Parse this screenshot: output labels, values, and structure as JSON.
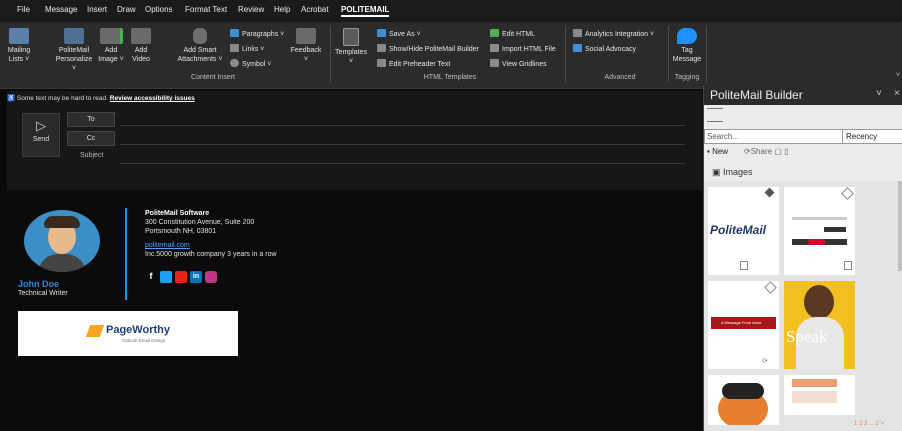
{
  "menu": [
    "File",
    "Message",
    "Insert",
    "Draw",
    "Options",
    "Format Text",
    "Review",
    "Help",
    "Acrobat",
    "POLITEMAIL"
  ],
  "ribbon": {
    "mailing_lists": "Mailing\nLists ˅",
    "politemail_personalize": "PoliteMail\nPersonalize ˅",
    "add_image": "Add\nImage ˅",
    "add_video": "Add\nVideo",
    "add_smart_attachments": "Add Smart\nAttachments ˅",
    "paragraphs": "Paragraphs ˅",
    "links": "Links ˅",
    "symbol": "Symbol ˅",
    "feedback": "Feedback\n˅",
    "templates": "Templates\n˅",
    "save_as": "Save As ˅",
    "show_hide_builder": "Show/Hide PoliteMail Builder",
    "edit_preheader": "Edit Preheader Text",
    "edit_html": "Edit HTML",
    "import_html": "Import HTML File",
    "view_gridlines": "View Gridlines",
    "analytics_integration": "Analytics Integration ˅",
    "social_advocacy": "Social Advocacy",
    "tag_message": "Tag\nMessage",
    "groups": {
      "content_insert": "Content Insert",
      "html_templates": "HTML Templates",
      "advanced": "Advanced",
      "tagging": "Tagging"
    }
  },
  "compose": {
    "accessibility_text": "Some text may be hard to read.",
    "accessibility_link": "Review accessibility issues",
    "send": "Send",
    "to": "To",
    "cc": "Cc",
    "subject": "Subject"
  },
  "signature": {
    "name": "John Doe",
    "title": "Technical Writer",
    "company": "PoliteMail Software",
    "address1": "300 Constitution Avenue, Suite 200",
    "address2": "Portsmouth NH, 03801",
    "website": "politemail.com",
    "tagline": "Inc.5000 growth company 3 years in a row",
    "banner_brand": "PageWorthy",
    "banner_sub": "Outlook Email Design",
    "social_icons": [
      "facebook-icon",
      "twitter-icon",
      "youtube-icon",
      "linkedin-icon",
      "instagram-icon"
    ]
  },
  "panel": {
    "title": "PoliteMail Builder",
    "search_placeholder": "Search...",
    "sort": "Recency",
    "new": "New",
    "share": "Share",
    "section": "Images",
    "thumb_logo": "PoliteMail",
    "thumb_banner": "A Message From Anne",
    "thumb_speak": "Speak",
    "pagination": "1 2 3 ... 2 >"
  },
  "colors": {
    "accent": "#1e90ff",
    "link": "#4ea3ff",
    "social_fb": "#3b5998",
    "social_tw": "#1da1f2",
    "social_yt": "#e62117",
    "social_li": "#0077b5",
    "social_ig": "#c13584"
  }
}
